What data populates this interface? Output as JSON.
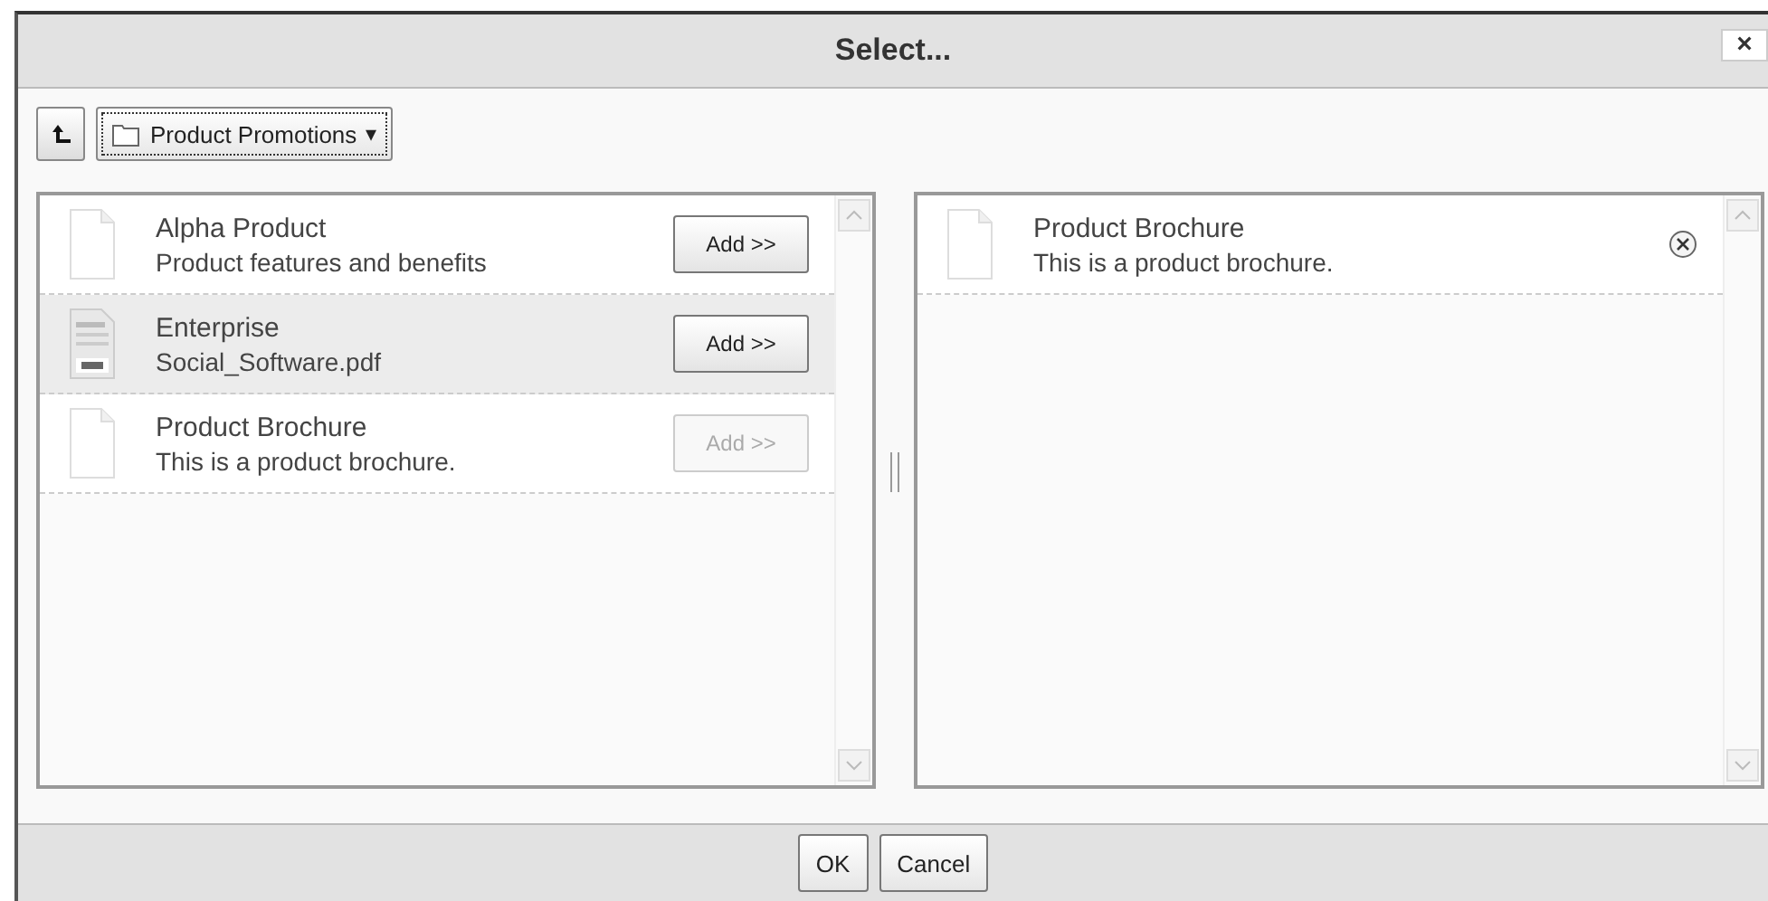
{
  "window": {
    "title": "Select...",
    "close": "×"
  },
  "toolbar": {
    "folder": "Product Promotions",
    "caret": "▾"
  },
  "available": [
    {
      "kind": "file",
      "title": "Alpha Product",
      "subtitle": "Product features and benefits",
      "selected": false,
      "add": {
        "label": "Add >>",
        "disabled": false
      }
    },
    {
      "kind": "pdf",
      "title": "Enterprise",
      "subtitle": "Social_Software.pdf",
      "selected": true,
      "add": {
        "label": "Add >>",
        "disabled": false
      }
    },
    {
      "kind": "file",
      "title": "Product Brochure",
      "subtitle": "This is a product brochure.",
      "selected": false,
      "add": {
        "label": "Add >>",
        "disabled": true
      }
    }
  ],
  "chosen": [
    {
      "kind": "file",
      "title": "Product Brochure",
      "subtitle": "This is a product brochure."
    }
  ],
  "buttons": [
    "OK",
    "Cancel"
  ]
}
